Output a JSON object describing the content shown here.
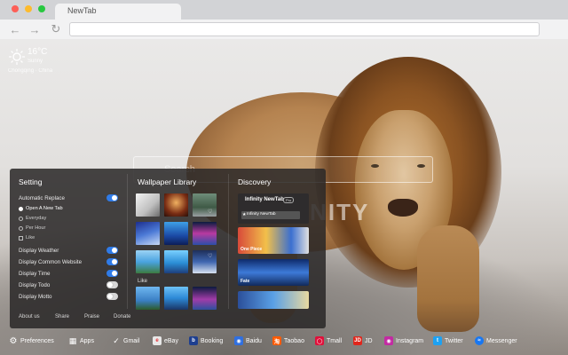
{
  "browser": {
    "tab_title": "NewTab"
  },
  "weather": {
    "temperature": "16°C",
    "condition": "Sunny",
    "city": "Chongqing · China"
  },
  "search": {
    "placeholder": "Search"
  },
  "logo_text": "INFINITY",
  "settings": {
    "title": "Setting",
    "auto_replace_label": "Automatic Replace",
    "radio_open_new_tab": "Open A New Tab",
    "radio_everyday": "Everyday",
    "radio_per_hour": "Per Hour",
    "check_like": "Like",
    "display_weather": "Display Weather",
    "display_common_website": "Display Common Website",
    "display_time": "Display Time",
    "display_todo": "Display Todo",
    "display_motto": "Display Motto",
    "footer": {
      "about": "About us",
      "share": "Share",
      "praise": "Praise",
      "donate": "Donate"
    }
  },
  "wallpaper": {
    "title": "Wallpaper Library",
    "like_label": "Like"
  },
  "discovery": {
    "title": "Discovery",
    "top_title": "Infinity NewTab",
    "pro_badge": "Pro",
    "bar_text": "Infinity NewTab",
    "cards": [
      "One Piece",
      "Fate"
    ]
  },
  "bottom_bar": [
    {
      "label": "Preferences",
      "icon": "gear-icon",
      "color": "#444444"
    },
    {
      "label": "Apps",
      "icon": "apps-grid-icon",
      "color": "#444444"
    },
    {
      "label": "Gmail",
      "icon": "check-icon",
      "color": "#444444"
    },
    {
      "label": "eBay",
      "icon": "ebay-icon",
      "color": "#e8e8e8"
    },
    {
      "label": "Booking",
      "icon": "booking-icon",
      "color": "#1e3f8f"
    },
    {
      "label": "Baidu",
      "icon": "baidu-icon",
      "color": "#2f6fe0"
    },
    {
      "label": "Taobao",
      "icon": "taobao-icon",
      "color": "#ff5a00"
    },
    {
      "label": "Tmall",
      "icon": "tmall-icon",
      "color": "#e0103a"
    },
    {
      "label": "JD",
      "icon": "jd-icon",
      "color": "#e1251b"
    },
    {
      "label": "Instagram",
      "icon": "instagram-icon",
      "color": "#c32aa3"
    },
    {
      "label": "Twitter",
      "icon": "twitter-icon",
      "color": "#1da1f2"
    },
    {
      "label": "Messenger",
      "icon": "messenger-icon",
      "color": "#1877f2"
    }
  ],
  "colors": {
    "accent": "#2f7be8",
    "panel_bg": "#2a2828"
  }
}
